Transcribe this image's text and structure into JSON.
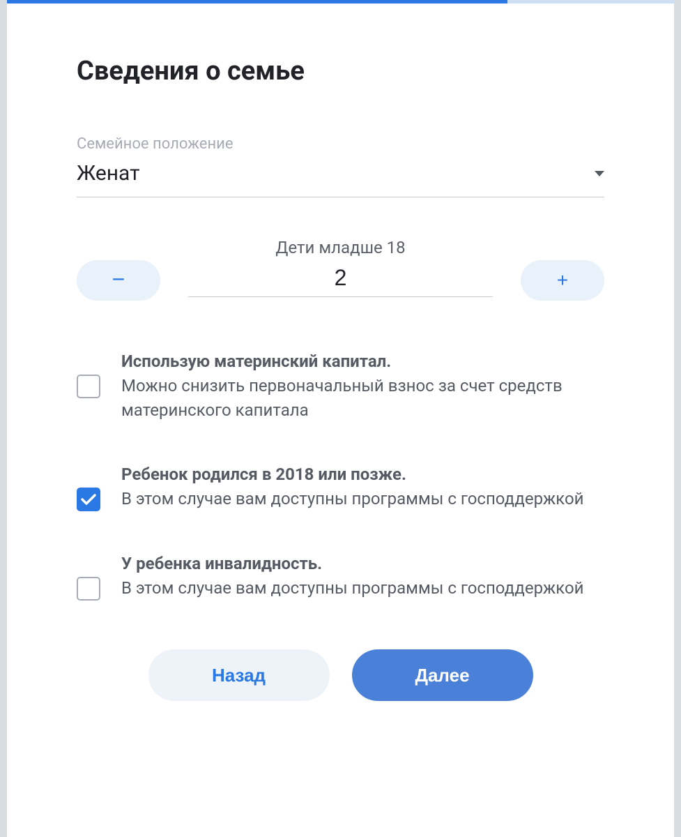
{
  "title": "Сведения о семье",
  "marital": {
    "label": "Семейное положение",
    "value": "Женат"
  },
  "children": {
    "label": "Дети младше 18",
    "value": "2",
    "minus": "−",
    "plus": "+"
  },
  "options": [
    {
      "title": "Использую материнский капитал.",
      "desc": "Можно снизить первоначальный взнос за счет средств материнского капитала",
      "checked": false
    },
    {
      "title": "Ребенок родился в 2018 или позже.",
      "desc": "В этом случае вам доступны программы с господдержкой",
      "checked": true
    },
    {
      "title": "У ребенка инвалидность.",
      "desc": "В этом случае вам доступны программы с господдержкой",
      "checked": false
    }
  ],
  "buttons": {
    "back": "Назад",
    "next": "Далее"
  },
  "progress_percent": 75
}
